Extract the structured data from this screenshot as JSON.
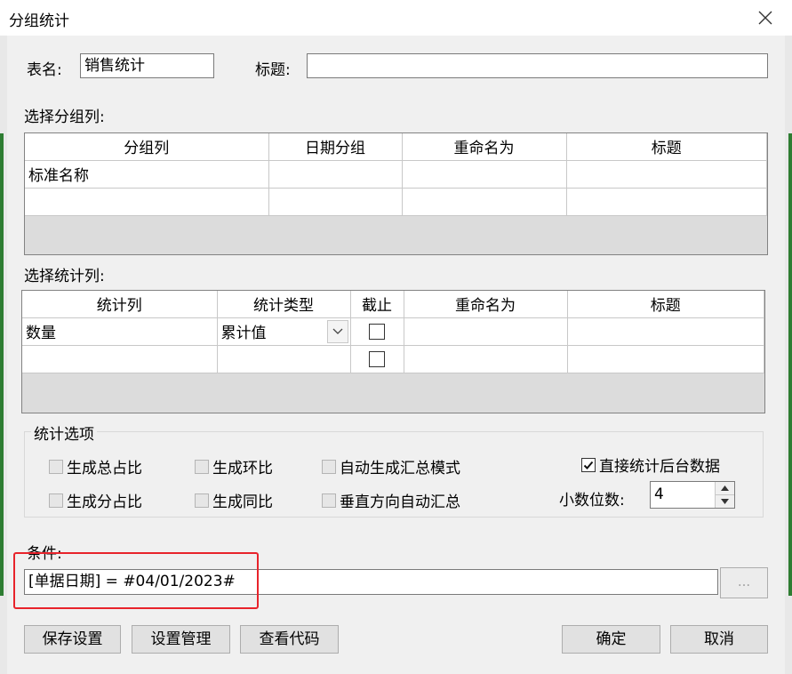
{
  "window": {
    "title": "分组统计"
  },
  "table_name": {
    "label": "表名:",
    "value": "销售统计"
  },
  "title_field": {
    "label": "标题:",
    "value": ""
  },
  "group_section": {
    "label": "选择分组列:",
    "headers": [
      "分组列",
      "日期分组",
      "重命名为",
      "标题"
    ],
    "rows": [
      [
        "标准名称",
        "",
        "",
        ""
      ],
      [
        "",
        "",
        "",
        ""
      ]
    ]
  },
  "stat_section": {
    "label": "选择统计列:",
    "headers": [
      "统计列",
      "统计类型",
      "截止",
      "重命名为",
      "标题"
    ],
    "rows": [
      {
        "col": "数量",
        "type": "累计值",
        "cutoff": false,
        "rename": "",
        "title": ""
      },
      {
        "col": "",
        "type": "",
        "cutoff": false,
        "rename": "",
        "title": ""
      }
    ]
  },
  "options": {
    "label": "统计选项",
    "total_ratio": "生成总占比",
    "ring_ratio": "生成环比",
    "auto_summary_mode": "自动生成汇总模式",
    "direct_backend": "直接统计后台数据",
    "direct_backend_checked": true,
    "sub_ratio": "生成分占比",
    "yoy_ratio": "生成同比",
    "vertical_auto_summary": "垂直方向自动汇总",
    "decimal_label": "小数位数:",
    "decimal_value": "4"
  },
  "condition": {
    "label": "条件:",
    "value": "[单据日期] = #04/01/2023#",
    "browse_label": "..."
  },
  "buttons": {
    "save_settings": "保存设置",
    "manage_settings": "设置管理",
    "view_code": "查看代码",
    "ok": "确定",
    "cancel": "取消"
  },
  "colors": {
    "highlight": "#e8232b"
  }
}
